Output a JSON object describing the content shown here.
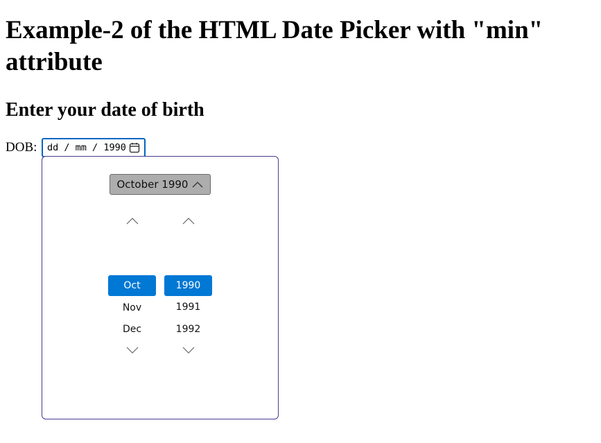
{
  "page": {
    "title": "Example-2 of the HTML Date Picker with \"min\" attribute",
    "subtitle": "Enter your date of birth"
  },
  "form": {
    "dob_label": "DOB:",
    "date_input": {
      "day_placeholder": "dd",
      "month_placeholder": "mm",
      "year_value": "1990",
      "separator": " / ",
      "icon": "calendar-icon"
    }
  },
  "picker": {
    "header_label": "October 1990",
    "header_icon": "chevron-up-icon",
    "months": [
      {
        "label": "Oct",
        "selected": true
      },
      {
        "label": "Nov",
        "selected": false
      },
      {
        "label": "Dec",
        "selected": false
      }
    ],
    "years": [
      {
        "label": "1990",
        "selected": true
      },
      {
        "label": "1991",
        "selected": false
      },
      {
        "label": "1992",
        "selected": false
      }
    ],
    "scroll_up_icon": "chevron-up-icon",
    "scroll_down_icon": "chevron-down-icon"
  },
  "colors": {
    "input_focus_border": "#0067c0",
    "selected_bg": "#0078d4",
    "header_button_bg": "#adadad",
    "picker_border": "#4b3b8f"
  }
}
